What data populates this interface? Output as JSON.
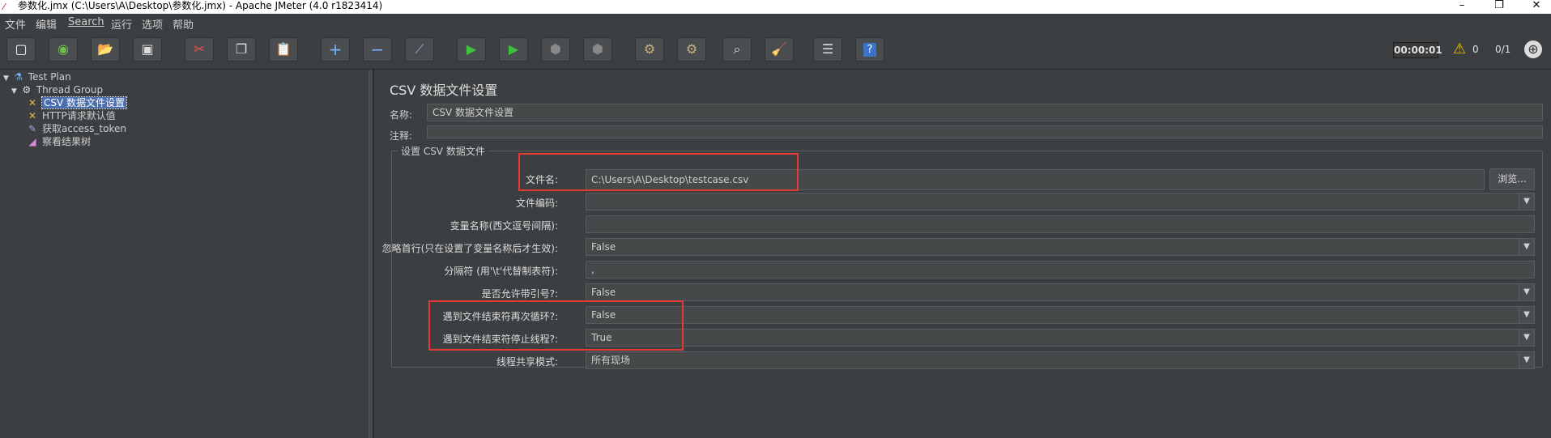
{
  "window": {
    "title": "参数化.jmx (C:\\Users\\A\\Desktop\\参数化.jmx) - Apache JMeter (4.0 r1823414)",
    "minimize": "–",
    "maximize": "❐",
    "close": "✕"
  },
  "menu": [
    "文件",
    "编辑",
    "Search",
    "运行",
    "选项",
    "帮助"
  ],
  "toolbar": {
    "buttons": [
      {
        "name": "new-icon",
        "glyph": "▢"
      },
      {
        "name": "templates-icon",
        "glyph": "◉"
      },
      {
        "name": "open-icon",
        "glyph": "📂"
      },
      {
        "name": "save-icon",
        "glyph": "▣"
      },
      {
        "name": "cut-icon",
        "glyph": "✂"
      },
      {
        "name": "copy-icon",
        "glyph": "❐"
      },
      {
        "name": "paste-icon",
        "glyph": "📋"
      },
      {
        "name": "expand-icon",
        "glyph": "+"
      },
      {
        "name": "collapse-icon",
        "glyph": "−"
      },
      {
        "name": "toggle-icon",
        "glyph": "⟋"
      },
      {
        "name": "start-icon",
        "glyph": "▶"
      },
      {
        "name": "start-no-pause-icon",
        "glyph": "▶"
      },
      {
        "name": "stop-icon",
        "glyph": "⬢"
      },
      {
        "name": "shutdown-icon",
        "glyph": "⬢"
      },
      {
        "name": "clear-icon",
        "glyph": "⚙"
      },
      {
        "name": "clear-all-icon",
        "glyph": "⚙"
      },
      {
        "name": "search-icon",
        "glyph": "⌕"
      },
      {
        "name": "reset-search-icon",
        "glyph": "🧹"
      },
      {
        "name": "function-helper-icon",
        "glyph": "☰"
      },
      {
        "name": "help-icon",
        "glyph": "?"
      }
    ],
    "timer": "00:00:01",
    "warnings": "0",
    "threads": "0/1"
  },
  "tree": {
    "items": [
      {
        "label": "Test Plan",
        "icon": "flask-icon",
        "glyph": "⚗"
      },
      {
        "label": "Thread Group",
        "icon": "gear-icon",
        "glyph": "⚙"
      },
      {
        "label": "CSV 数据文件设置",
        "icon": "wrench-icon",
        "glyph": "✕"
      },
      {
        "label": "HTTP请求默认值",
        "icon": "wrench-icon",
        "glyph": "✕"
      },
      {
        "label": "获取access_token",
        "icon": "pipette-icon",
        "glyph": "✎"
      },
      {
        "label": "察看结果树",
        "icon": "chart-icon",
        "glyph": "◢"
      }
    ]
  },
  "panel": {
    "title": "CSV 数据文件设置",
    "name_label": "名称:",
    "name_value": "CSV 数据文件设置",
    "comment_label": "注释:",
    "comment_value": "",
    "group_title": "设置 CSV 数据文件",
    "browse_label": "浏览...",
    "fields": [
      {
        "label": "文件名:",
        "value": "C:\\Users\\A\\Desktop\\testcase.csv",
        "combo": false
      },
      {
        "label": "文件编码:",
        "value": "",
        "combo": true
      },
      {
        "label": "变量名称(西文逗号间隔):",
        "value": "",
        "combo": false
      },
      {
        "label": "忽略首行(只在设置了变量名称后才生效):",
        "value": "False",
        "combo": true
      },
      {
        "label": "分隔符 (用'\\t'代替制表符):",
        "value": ",",
        "combo": false
      },
      {
        "label": "是否允许带引号?:",
        "value": "False",
        "combo": true
      },
      {
        "label": "遇到文件结束符再次循环?:",
        "value": "False",
        "combo": true
      },
      {
        "label": "遇到文件结束符停止线程?:",
        "value": "True",
        "combo": true
      },
      {
        "label": "线程共享模式:",
        "value": "所有现场",
        "combo": true
      }
    ]
  },
  "colors": {
    "background": "#3c3f41",
    "selection": "#4b6eaf",
    "highlight_box": "#e53935"
  }
}
